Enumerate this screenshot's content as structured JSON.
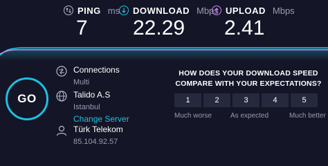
{
  "stats": {
    "ping": {
      "label": "PING",
      "unit": "ms",
      "value": "7"
    },
    "download": {
      "label": "DOWNLOAD",
      "unit": "Mbps",
      "value": "22.29"
    },
    "upload": {
      "label": "UPLOAD",
      "unit": "Mbps",
      "value": "2.41"
    }
  },
  "go_button": {
    "label": "GO"
  },
  "connections": {
    "label": "Connections",
    "value": "Multi"
  },
  "server": {
    "name": "Talido A.S",
    "location": "Istanbul",
    "change_label": "Change Server"
  },
  "provider": {
    "name": "Türk Telekom",
    "ip": "85.104.92.57"
  },
  "survey": {
    "question": "HOW DOES YOUR DOWNLOAD SPEED COMPARE WITH YOUR EXPECTATIONS?",
    "options": [
      "1",
      "2",
      "3",
      "4",
      "5"
    ],
    "low_label": "Much worse",
    "mid_label": "As expected",
    "high_label": "Much better"
  },
  "colors": {
    "accent": "#1fc0e0",
    "upload": "#c18cf0",
    "background": "#141526"
  }
}
